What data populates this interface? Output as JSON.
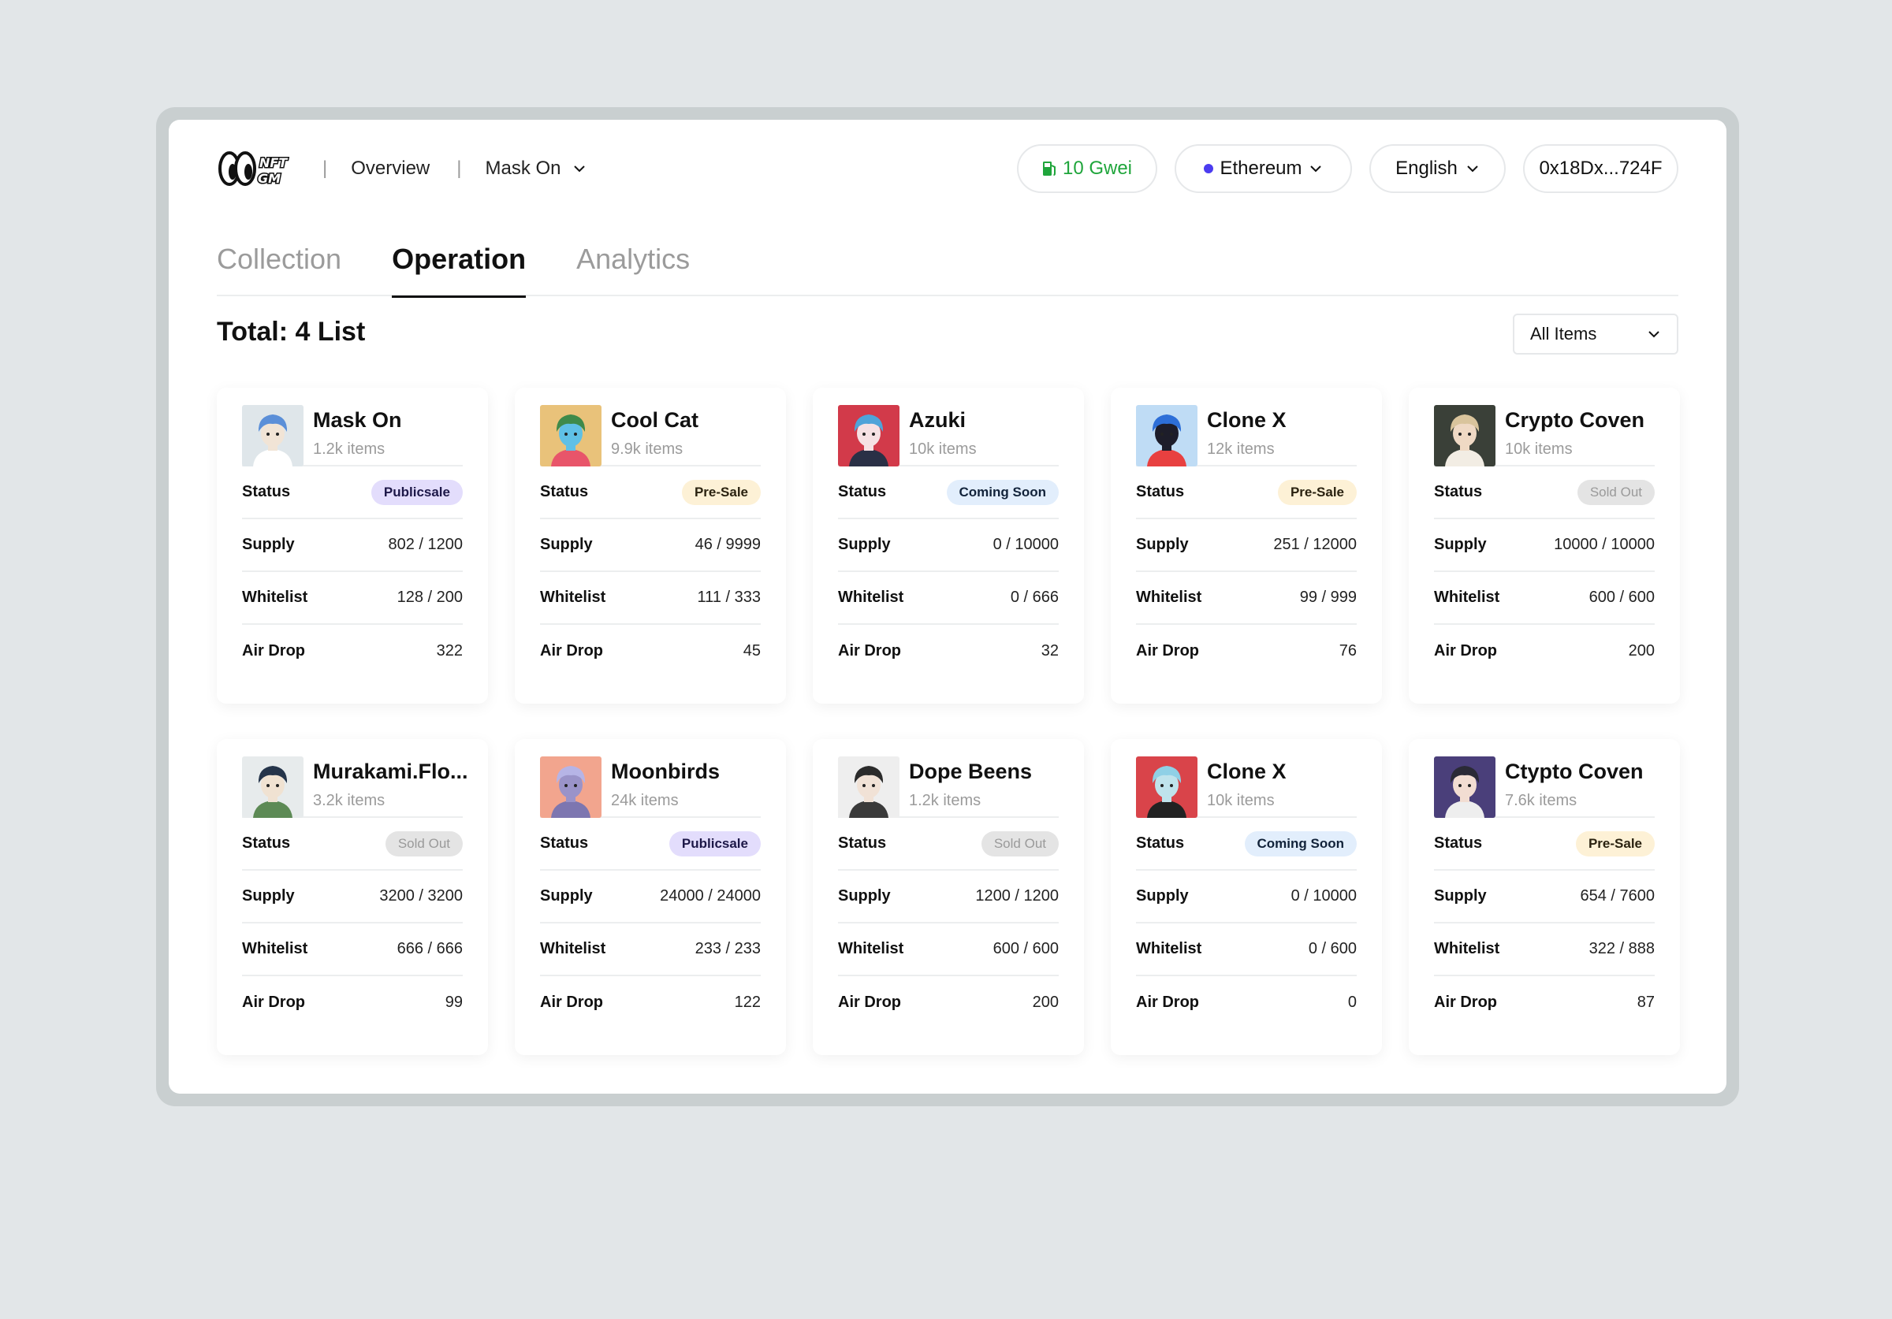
{
  "brand": {
    "logo_text": "NFT GM"
  },
  "nav": {
    "overview": "Overview",
    "collection_select": "Mask On"
  },
  "top": {
    "gas": "10 Gwei",
    "network": "Ethereum",
    "language": "English",
    "wallet": "0x18Dx...724F"
  },
  "tabs": [
    {
      "label": "Collection"
    },
    {
      "label": "Operation"
    },
    {
      "label": "Analytics"
    }
  ],
  "summary": {
    "total": "Total: 4 List"
  },
  "filter": {
    "label": "All Items"
  },
  "labels": {
    "status": "Status",
    "supply": "Supply",
    "whitelist": "Whitelist",
    "airdrop": "Air Drop"
  },
  "cards": [
    {
      "name": "Mask On",
      "items": "1.2k items",
      "status": "Publicsale",
      "status_kind": "publicsale",
      "supply": "802 / 1200",
      "whitelist": "128 / 200",
      "airdrop": "322",
      "avatar": {
        "bg": "#dfe6ea",
        "hair": "#5b8fd8",
        "skin": "#f1e4d6",
        "shirt": "#ffffff"
      }
    },
    {
      "name": "Cool Cat",
      "items": "9.9k items",
      "status": "Pre-Sale",
      "status_kind": "presale",
      "supply": "46 / 9999",
      "whitelist": "111 / 333",
      "airdrop": "45",
      "avatar": {
        "bg": "#e9c27a",
        "hair": "#3f8a4a",
        "skin": "#5fc0e6",
        "shirt": "#e8556a"
      }
    },
    {
      "name": "Azuki",
      "items": "10k items",
      "status": "Coming Soon",
      "status_kind": "coming",
      "supply": "0 / 10000",
      "whitelist": "0 / 666",
      "airdrop": "32",
      "avatar": {
        "bg": "#d23a4a",
        "hair": "#4fa3d9",
        "skin": "#f6e1e4",
        "shirt": "#2a3046"
      }
    },
    {
      "name": "Clone X",
      "items": "12k items",
      "status": "Pre-Sale",
      "status_kind": "presale",
      "supply": "251 / 12000",
      "whitelist": "99 / 999",
      "airdrop": "76",
      "avatar": {
        "bg": "#bfdcf5",
        "hair": "#2d6fd8",
        "skin": "#1d1d2a",
        "shirt": "#e84040"
      }
    },
    {
      "name": "Crypto Coven",
      "items": "10k items",
      "status": "Sold Out",
      "status_kind": "soldout",
      "supply": "10000 / 10000",
      "whitelist": "600 / 600",
      "airdrop": "200",
      "avatar": {
        "bg": "#3a4038",
        "hair": "#d9c49c",
        "skin": "#efd9c4",
        "shirt": "#f2ede4"
      }
    },
    {
      "name": "Murakami.Flo...",
      "items": "3.2k items",
      "status": "Sold Out",
      "status_kind": "soldout",
      "supply": "3200 / 3200",
      "whitelist": "666 / 666",
      "airdrop": "99",
      "avatar": {
        "bg": "#e7ebec",
        "hair": "#25344a",
        "skin": "#f0e2d2",
        "shirt": "#5d8a55"
      }
    },
    {
      "name": "Moonbirds",
      "items": "24k items",
      "status": "Publicsale",
      "status_kind": "publicsale",
      "supply": "24000 / 24000",
      "whitelist": "233 / 233",
      "airdrop": "122",
      "avatar": {
        "bg": "#f2a58e",
        "hair": "#b6b4e6",
        "skin": "#9a93c9",
        "shirt": "#7d76b0"
      }
    },
    {
      "name": "Dope Beens",
      "items": "1.2k items",
      "status": "Sold Out",
      "status_kind": "soldout",
      "supply": "1200 / 1200",
      "whitelist": "600 / 600",
      "airdrop": "200",
      "avatar": {
        "bg": "#eeeeee",
        "hair": "#2b2b2b",
        "skin": "#f1e2d6",
        "shirt": "#3a3a3a"
      }
    },
    {
      "name": "Clone X",
      "items": "10k items",
      "status": "Coming Soon",
      "status_kind": "coming",
      "supply": "0 / 10000",
      "whitelist": "0 / 600",
      "airdrop": "0",
      "avatar": {
        "bg": "#d9444a",
        "hair": "#8fd0e6",
        "skin": "#bfe3ec",
        "shirt": "#222222"
      }
    },
    {
      "name": "Ctypto Coven",
      "items": "7.6k items",
      "status": "Pre-Sale",
      "status_kind": "presale",
      "supply": "654 / 7600",
      "whitelist": "322 / 888",
      "airdrop": "87",
      "avatar": {
        "bg": "#4a3f7a",
        "hair": "#2a2a36",
        "skin": "#f2ddd2",
        "shirt": "#eeeeee"
      }
    }
  ]
}
